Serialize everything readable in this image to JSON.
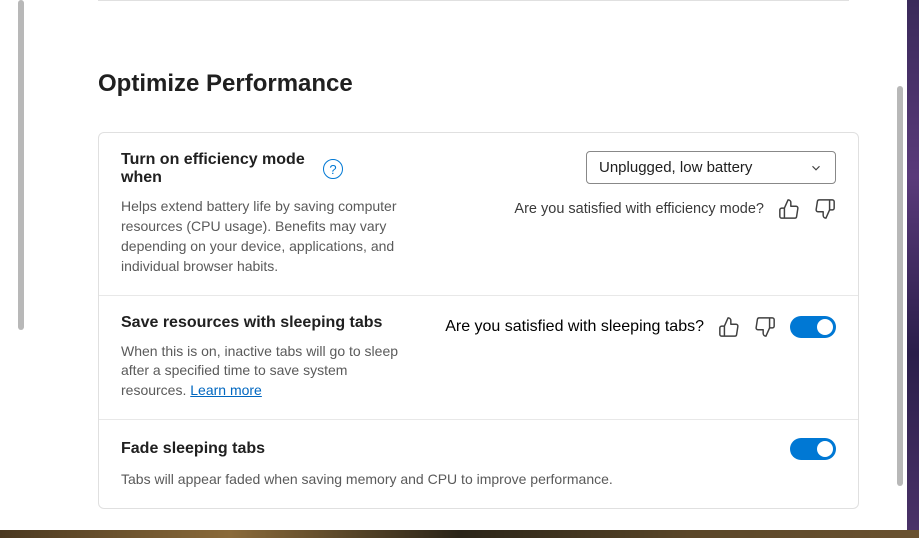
{
  "section": {
    "title": "Optimize Performance"
  },
  "efficiency": {
    "title": "Turn on efficiency mode when",
    "desc": "Helps extend battery life by saving computer resources (CPU usage). Benefits may vary depending on your device, applications, and individual browser habits.",
    "dropdown_value": "Unplugged, low battery",
    "feedback_label": "Are you satisfied with efficiency mode?"
  },
  "sleeping": {
    "title": "Save resources with sleeping tabs",
    "desc_prefix": "When this is on, inactive tabs will go to sleep after a specified time to save system resources. ",
    "learn_more": "Learn more",
    "feedback_label": "Are you satisfied with sleeping tabs?"
  },
  "fade": {
    "title": "Fade sleeping tabs",
    "desc": "Tabs will appear faded when saving memory and CPU to improve performance."
  }
}
